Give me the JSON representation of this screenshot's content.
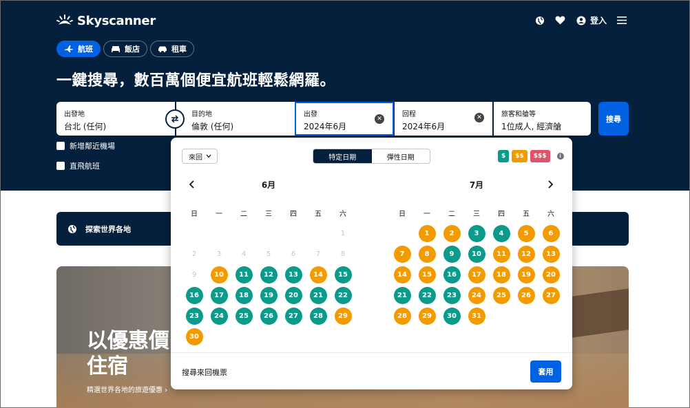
{
  "brand": {
    "name": "Skyscanner"
  },
  "header": {
    "login_label": "登入"
  },
  "tabs": [
    {
      "label": "航班",
      "icon": "plane-icon",
      "active": true
    },
    {
      "label": "飯店",
      "icon": "bed-icon",
      "active": false
    },
    {
      "label": "租車",
      "icon": "car-icon",
      "active": false
    }
  ],
  "headline": "一鍵搜尋，數百萬個便宜航班輕鬆網羅。",
  "search": {
    "origin": {
      "label": "出發地",
      "value": "台北 (任何)"
    },
    "destination": {
      "label": "目的地",
      "value": "倫敦 (任何)"
    },
    "depart": {
      "label": "出發",
      "value": "2024年6月"
    },
    "return": {
      "label": "回程",
      "value": "2024年6月"
    },
    "passengers": {
      "label": "旅客和艙等",
      "value": "1位成人, 經濟艙"
    },
    "button": "搜尋"
  },
  "checkboxes": [
    {
      "label": "新增鄰近機場",
      "checked": false
    },
    {
      "label": "直飛航班",
      "checked": false
    }
  ],
  "explore": {
    "label": "探索世界各地"
  },
  "promo": {
    "title_line1": "以優惠價",
    "title_line2": "住宿",
    "subtitle": "精選世界各地的旅遊優惠 ›"
  },
  "calendar": {
    "trip_type": "來回",
    "toggle": {
      "specific": "特定日期",
      "flexible": "彈性日期"
    },
    "price_legend": {
      "low": "$",
      "mid": "$$",
      "high": "$$$"
    },
    "weekdays": [
      "日",
      "一",
      "二",
      "三",
      "四",
      "五",
      "六"
    ],
    "months": [
      {
        "title": "6月",
        "lead_blank": 6,
        "days": [
          {
            "d": "1",
            "s": "off"
          },
          {
            "d": "2",
            "s": "off"
          },
          {
            "d": "3",
            "s": "off"
          },
          {
            "d": "4",
            "s": "off"
          },
          {
            "d": "5",
            "s": "off"
          },
          {
            "d": "6",
            "s": "off"
          },
          {
            "d": "7",
            "s": "off"
          },
          {
            "d": "8",
            "s": "off"
          },
          {
            "d": "9",
            "s": "off"
          },
          {
            "d": "10",
            "s": "mid"
          },
          {
            "d": "11",
            "s": "low"
          },
          {
            "d": "12",
            "s": "low"
          },
          {
            "d": "13",
            "s": "low"
          },
          {
            "d": "14",
            "s": "mid"
          },
          {
            "d": "15",
            "s": "low"
          },
          {
            "d": "16",
            "s": "low"
          },
          {
            "d": "17",
            "s": "low"
          },
          {
            "d": "18",
            "s": "low"
          },
          {
            "d": "19",
            "s": "low"
          },
          {
            "d": "20",
            "s": "low"
          },
          {
            "d": "21",
            "s": "low"
          },
          {
            "d": "22",
            "s": "low"
          },
          {
            "d": "23",
            "s": "low"
          },
          {
            "d": "24",
            "s": "low"
          },
          {
            "d": "25",
            "s": "low"
          },
          {
            "d": "26",
            "s": "low"
          },
          {
            "d": "27",
            "s": "low"
          },
          {
            "d": "28",
            "s": "low"
          },
          {
            "d": "29",
            "s": "mid"
          },
          {
            "d": "30",
            "s": "mid"
          }
        ]
      },
      {
        "title": "7月",
        "lead_blank": 1,
        "days": [
          {
            "d": "1",
            "s": "mid"
          },
          {
            "d": "2",
            "s": "mid"
          },
          {
            "d": "3",
            "s": "low"
          },
          {
            "d": "4",
            "s": "low"
          },
          {
            "d": "5",
            "s": "mid"
          },
          {
            "d": "6",
            "s": "mid"
          },
          {
            "d": "7",
            "s": "mid"
          },
          {
            "d": "8",
            "s": "mid"
          },
          {
            "d": "9",
            "s": "low"
          },
          {
            "d": "10",
            "s": "low"
          },
          {
            "d": "11",
            "s": "mid"
          },
          {
            "d": "12",
            "s": "mid"
          },
          {
            "d": "13",
            "s": "mid"
          },
          {
            "d": "14",
            "s": "mid"
          },
          {
            "d": "15",
            "s": "mid"
          },
          {
            "d": "16",
            "s": "low"
          },
          {
            "d": "17",
            "s": "mid"
          },
          {
            "d": "18",
            "s": "mid"
          },
          {
            "d": "19",
            "s": "mid"
          },
          {
            "d": "20",
            "s": "mid"
          },
          {
            "d": "21",
            "s": "low"
          },
          {
            "d": "22",
            "s": "low"
          },
          {
            "d": "23",
            "s": "low"
          },
          {
            "d": "24",
            "s": "mid"
          },
          {
            "d": "25",
            "s": "mid"
          },
          {
            "d": "26",
            "s": "mid"
          },
          {
            "d": "27",
            "s": "mid"
          },
          {
            "d": "28",
            "s": "mid"
          },
          {
            "d": "29",
            "s": "mid"
          },
          {
            "d": "30",
            "s": "low"
          },
          {
            "d": "31",
            "s": "mid"
          }
        ]
      }
    ],
    "footer_note": "搜尋來回機票",
    "apply": "套用"
  }
}
